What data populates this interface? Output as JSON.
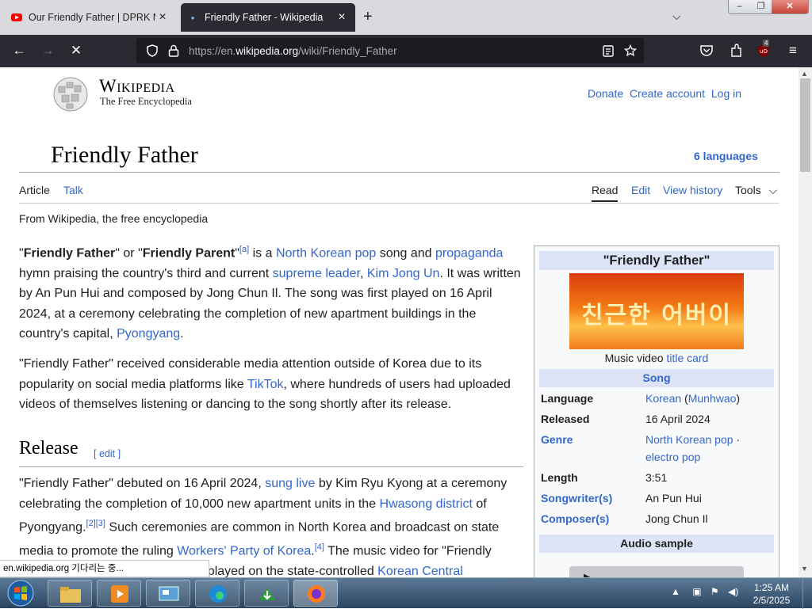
{
  "browser": {
    "tabs": [
      {
        "title": "Our Friendly Father | DPRK Mus",
        "active": false
      },
      {
        "title": "Friendly Father - Wikipedia",
        "active": true
      }
    ],
    "new_tab_icon": "plus-icon",
    "url_prefix": "https://en.",
    "url_domain": "wikipedia.org",
    "url_path": "/wiki/Friendly_Father",
    "extension_badge": "4",
    "status_text": "en.wikipedia.org 기다리는 중..."
  },
  "wiki": {
    "wordmark": "Wikipedia",
    "tagline": "The Free Encyclopedia",
    "user_links": [
      "Donate",
      "Create account",
      "Log in"
    ],
    "title": "Friendly Father",
    "languages": "6 languages",
    "tabs": {
      "article": "Article",
      "talk": "Talk",
      "read": "Read",
      "edit": "Edit",
      "history": "View history",
      "tools": "Tools"
    },
    "from": "From Wikipedia, the free encyclopedia",
    "section_release": "Release",
    "edit_link": "[ edit ]"
  },
  "infobox": {
    "title": "\"Friendly Father\"",
    "image_text": "친근한 어버이",
    "caption_prefix": "Music video ",
    "caption_link": "title card",
    "song_header": "Song",
    "rows": [
      {
        "key": "Language",
        "value": "Korean",
        "value2": "Munhwao"
      },
      {
        "key": "Released",
        "value": "16 April 2024"
      },
      {
        "key": "Genre",
        "value": "North Korean pop",
        "value2": "electro pop"
      },
      {
        "key": "Length",
        "value": "3:51"
      },
      {
        "key": "Songwriter(s)",
        "value": "An Pun Hui"
      },
      {
        "key": "Composer(s)",
        "value": "Jong Chun Il"
      }
    ],
    "audio_header": "Audio sample"
  },
  "taskbar": {
    "time": "1:25 AM",
    "date": "2/5/2025"
  }
}
